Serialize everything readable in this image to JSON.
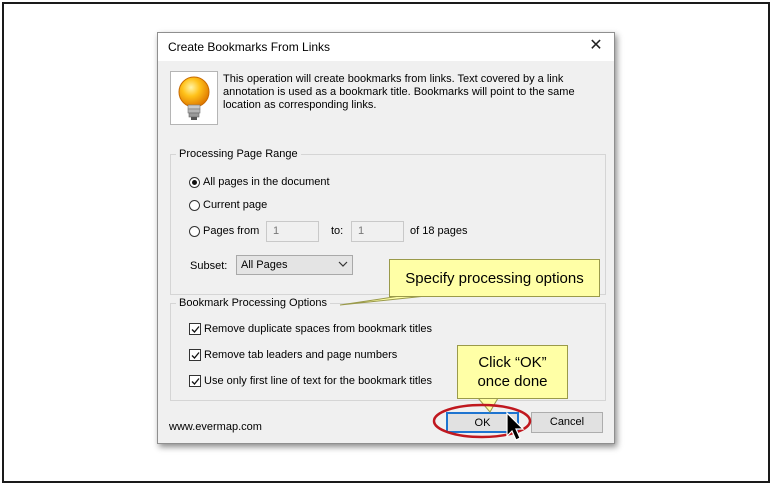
{
  "dialog": {
    "title": "Create Bookmarks From Links",
    "close_glyph": "✕",
    "info_text": "This operation will create bookmarks from links. Text covered by a link annotation is used as a bookmark title. Bookmarks will point to the same location as corresponding links.",
    "icon": "lightbulb-icon"
  },
  "page_range": {
    "label": "Processing Page Range",
    "options": [
      {
        "label": "All pages in the document",
        "selected": true
      },
      {
        "label": "Current page",
        "selected": false
      },
      {
        "label": "Pages from",
        "selected": false
      }
    ],
    "from_value": "1",
    "to_label": "to:",
    "to_value": "1",
    "of_pages": "of 18 pages",
    "subset_label": "Subset:",
    "subset_value": "All Pages"
  },
  "options": {
    "label": "Bookmark Processing Options",
    "items": [
      {
        "label": "Remove duplicate spaces from bookmark titles",
        "checked": true
      },
      {
        "label": "Remove tab leaders and page numbers",
        "checked": true
      },
      {
        "label": "Use only first line of text for the bookmark titles",
        "checked": true
      }
    ]
  },
  "footer": {
    "url": "www.evermap.com",
    "ok_label": "OK",
    "cancel_label": "Cancel"
  },
  "annotations": {
    "callout1": "Specify processing options",
    "callout2_line1": "Click “OK”",
    "callout2_line2": "once done",
    "callout_color": "#ffffa6",
    "highlight_color": "#c0181f"
  }
}
